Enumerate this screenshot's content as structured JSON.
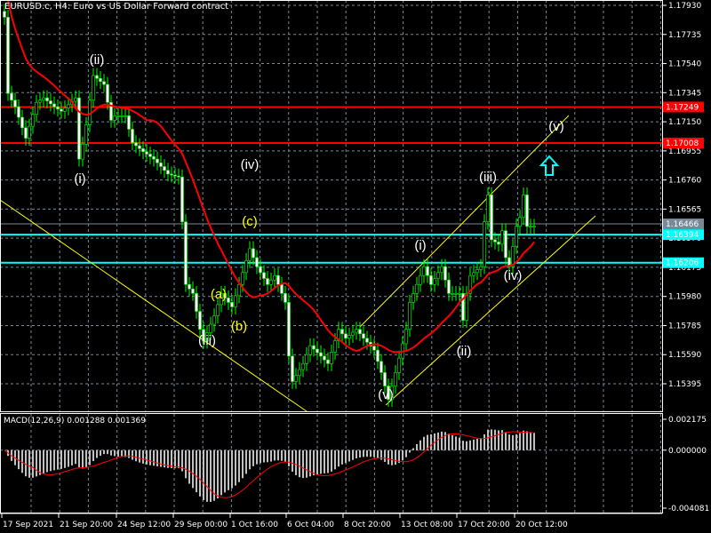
{
  "chart_data": {
    "type": "candlestick",
    "title": "EURUSD.c, H4:  Euro vs US Dollar Forward contract",
    "price_ticks": [
      "1.17930",
      "1.17735",
      "1.17540",
      "1.17345",
      "1.17150",
      "1.16955",
      "1.16760",
      "1.16565",
      "1.16370",
      "1.16175",
      "1.15980",
      "1.15785",
      "1.15590",
      "1.15395"
    ],
    "ylim": [
      1.1522,
      1.1797
    ],
    "time_labels": [
      "17 Sep 2021",
      "21 Sep 20:00",
      "24 Sep 12:00",
      "29 Sep 00:00",
      "1 Oct 16:00",
      "6 Oct 04:00",
      "8 Oct 20:00",
      "13 Oct 08:00",
      "17 Oct 20:00",
      "20 Oct 12:00"
    ],
    "bar_count": 150,
    "close_path": [
      [
        0,
        1.1785
      ],
      [
        1,
        1.1734
      ],
      [
        3,
        1.1725
      ],
      [
        6,
        1.1704
      ],
      [
        9,
        1.1728
      ],
      [
        11,
        1.1731
      ],
      [
        14,
        1.1725
      ],
      [
        16,
        1.1722
      ],
      [
        20,
        1.1731
      ],
      [
        21,
        1.169
      ],
      [
        22,
        1.17
      ],
      [
        23,
        1.1713
      ],
      [
        25,
        1.1746
      ],
      [
        28,
        1.174
      ],
      [
        30,
        1.1716
      ],
      [
        31,
        1.1719
      ],
      [
        34,
        1.1719
      ],
      [
        36,
        1.1701
      ],
      [
        39,
        1.1695
      ],
      [
        42,
        1.169
      ],
      [
        46,
        1.168
      ],
      [
        49,
        1.1678
      ],
      [
        50,
        1.1648
      ],
      [
        51,
        1.1606
      ],
      [
        53,
        1.16
      ],
      [
        55,
        1.1576
      ],
      [
        56,
        1.1568
      ],
      [
        59,
        1.1585
      ],
      [
        61,
        1.16
      ],
      [
        64,
        1.1591
      ],
      [
        66,
        1.1606
      ],
      [
        69,
        1.163
      ],
      [
        71,
        1.1618
      ],
      [
        74,
        1.1606
      ],
      [
        76,
        1.1612
      ],
      [
        79,
        1.1594
      ],
      [
        80,
        1.1558
      ],
      [
        81,
        1.1541
      ],
      [
        84,
        1.1553
      ],
      [
        86,
        1.1565
      ],
      [
        89,
        1.1558
      ],
      [
        91,
        1.1553
      ],
      [
        94,
        1.1576
      ],
      [
        96,
        1.157
      ],
      [
        99,
        1.1576
      ],
      [
        101,
        1.157
      ],
      [
        104,
        1.1562
      ],
      [
        106,
        1.1547
      ],
      [
        108,
        1.1529
      ],
      [
        110,
        1.1547
      ],
      [
        113,
        1.1576
      ],
      [
        114,
        1.1594
      ],
      [
        116,
        1.1606
      ],
      [
        118,
        1.1618
      ],
      [
        120,
        1.1606
      ],
      [
        123,
        1.1618
      ],
      [
        125,
        1.16
      ],
      [
        128,
        1.16
      ],
      [
        129,
        1.1582
      ],
      [
        130,
        1.16
      ],
      [
        131,
        1.1612
      ],
      [
        134,
        1.1618
      ],
      [
        135,
        1.1648
      ],
      [
        136,
        1.1666
      ],
      [
        137,
        1.1636
      ],
      [
        139,
        1.1633
      ],
      [
        140,
        1.1642
      ],
      [
        141,
        1.1624
      ],
      [
        142,
        1.1618
      ],
      [
        144,
        1.1645
      ],
      [
        145,
        1.1651
      ],
      [
        146,
        1.1666
      ],
      [
        147,
        1.1645
      ],
      [
        149,
        1.1645
      ]
    ],
    "levels": [
      {
        "label": "1.17249",
        "price": 1.17249,
        "color": "#ff0000"
      },
      {
        "label": "1.17008",
        "price": 1.17008,
        "color": "#ff0000"
      },
      {
        "label": "1.16466",
        "price": 1.16466,
        "color": "#778899"
      },
      {
        "label": "1.16394",
        "price": 1.16394,
        "color": "#00ffff"
      },
      {
        "label": "1.16206",
        "price": 1.16206,
        "color": "#00ffff"
      }
    ],
    "wave_labels": [
      "(i)",
      "(ii)",
      "(iii)",
      "(iv)",
      "(v)",
      "(a)",
      "(b)",
      "(c)"
    ],
    "indicator": {
      "title": "MACD(12,26,9) 0.001288 0.001369",
      "ticks": [
        "0.002175",
        "0.000000",
        "-0.004081"
      ],
      "ylim": [
        -0.004081,
        0.002175
      ]
    },
    "colors": {
      "bull": "#00ff00",
      "ma": "#ff0000",
      "grid": "#778899",
      "trend": "#ffff00",
      "arrow": "#00ffff"
    }
  }
}
